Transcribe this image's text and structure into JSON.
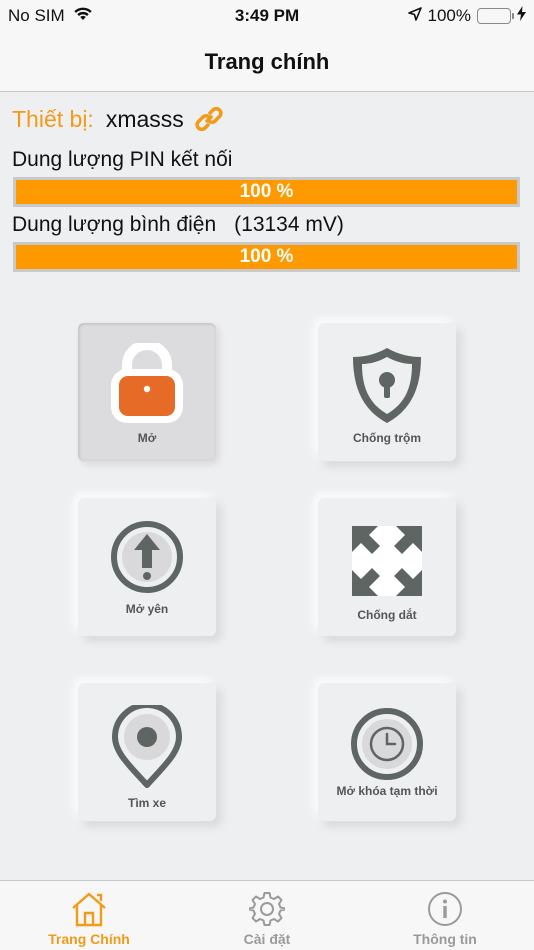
{
  "status_bar": {
    "carrier": "No SIM",
    "time": "3:49 PM",
    "battery": "100%",
    "icons": [
      "wifi-icon",
      "location-arrow-icon",
      "battery-icon",
      "charging-bolt-icon"
    ]
  },
  "nav": {
    "title": "Trang chính"
  },
  "device": {
    "label": "Thiết bị:",
    "name": "xmasss",
    "icon": "link-icon",
    "accent_color": "#f29a1a"
  },
  "pin": {
    "label": "Dung lượng PIN kết nối",
    "value_text": "100 %",
    "fraction": 1.0
  },
  "battery_level": {
    "label": "Dung lượng bình điện",
    "voltage": "(13134 mV)",
    "value_text": "100 %",
    "fraction": 1.0
  },
  "bar_color": "#ff9900",
  "actions": [
    {
      "label": "Mở",
      "icon": "padlock-icon",
      "active": true
    },
    {
      "label": "Chống trộm",
      "icon": "shield-keyhole-icon",
      "active": false
    },
    {
      "label": "Mở yên",
      "icon": "arrow-up-circle-icon",
      "active": false
    },
    {
      "label": "Chống dắt",
      "icon": "expand-arrows-icon",
      "active": false
    },
    {
      "label": "Tìm xe",
      "icon": "map-pin-icon",
      "active": false
    },
    {
      "label": "Mở khóa tạm thời",
      "icon": "clock-timer-icon",
      "active": false
    }
  ],
  "tabs": [
    {
      "label": "Trang Chính",
      "icon": "home-icon",
      "active": true
    },
    {
      "label": "Cài đặt",
      "icon": "gear-icon",
      "active": false
    },
    {
      "label": "Thông tin",
      "icon": "info-icon",
      "active": false
    }
  ]
}
